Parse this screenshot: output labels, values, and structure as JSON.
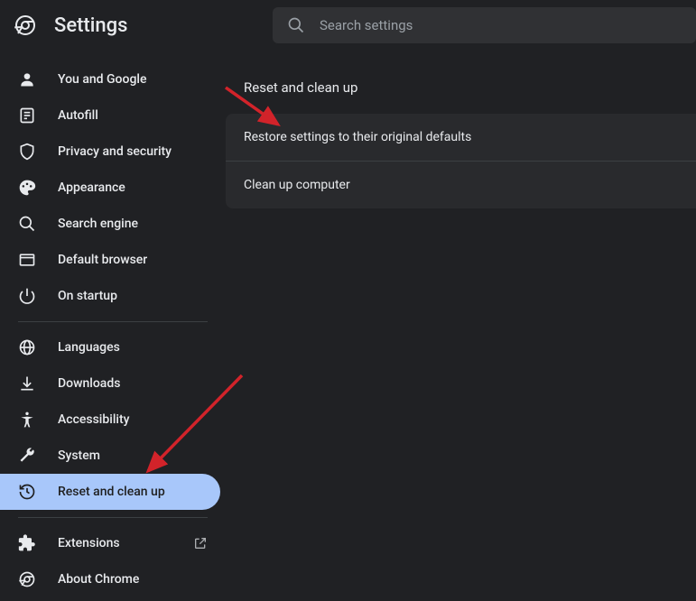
{
  "header": {
    "title": "Settings",
    "search_placeholder": "Search settings"
  },
  "sidebar": {
    "group1": [
      {
        "id": "you-and-google",
        "label": "You and Google",
        "icon": "person-icon"
      },
      {
        "id": "autofill",
        "label": "Autofill",
        "icon": "autofill-icon"
      },
      {
        "id": "privacy-and-security",
        "label": "Privacy and security",
        "icon": "shield-icon"
      },
      {
        "id": "appearance",
        "label": "Appearance",
        "icon": "palette-icon"
      },
      {
        "id": "search-engine",
        "label": "Search engine",
        "icon": "search-icon"
      },
      {
        "id": "default-browser",
        "label": "Default browser",
        "icon": "browser-icon"
      },
      {
        "id": "on-startup",
        "label": "On startup",
        "icon": "power-icon"
      }
    ],
    "group2": [
      {
        "id": "languages",
        "label": "Languages",
        "icon": "globe-icon"
      },
      {
        "id": "downloads",
        "label": "Downloads",
        "icon": "download-icon"
      },
      {
        "id": "accessibility",
        "label": "Accessibility",
        "icon": "accessibility-icon"
      },
      {
        "id": "system",
        "label": "System",
        "icon": "wrench-icon"
      },
      {
        "id": "reset-and-clean-up",
        "label": "Reset and clean up",
        "icon": "restore-icon",
        "active": true
      }
    ],
    "group3": [
      {
        "id": "extensions",
        "label": "Extensions",
        "icon": "puzzle-icon",
        "external": true
      },
      {
        "id": "about-chrome",
        "label": "About Chrome",
        "icon": "chrome-icon"
      }
    ]
  },
  "main": {
    "section_title": "Reset and clean up",
    "rows": [
      {
        "id": "restore-defaults",
        "label": "Restore settings to their original defaults"
      },
      {
        "id": "clean-up",
        "label": "Clean up computer"
      }
    ]
  },
  "colors": {
    "bg": "#202124",
    "card": "#292a2d",
    "active": "#a8c7fa",
    "arrow": "#d2232a"
  }
}
